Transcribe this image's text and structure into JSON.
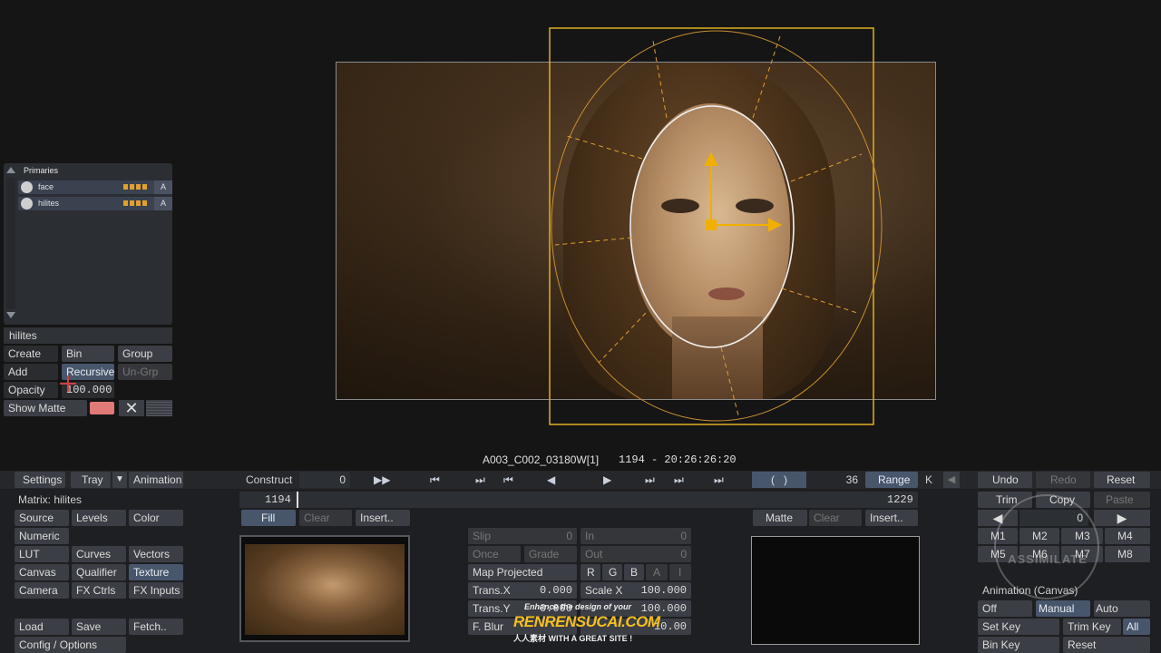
{
  "tray": {
    "title": "Primaries",
    "layers": [
      {
        "name": "face",
        "tag": "A"
      },
      {
        "name": "hilites",
        "tag": "A"
      }
    ],
    "selected_name": "hilites",
    "create": "Create",
    "bin": "Bin",
    "group": "Group",
    "add": "Add",
    "recursive": "Recursive",
    "ungrp": "Un-Grp",
    "opacity_label": "Opacity",
    "opacity_value": "100.000",
    "show_matte": "Show Matte"
  },
  "clip": {
    "name": "A003_C002_03180W[1]",
    "timecode": "1194 - 20:26:26:20"
  },
  "toolbar": {
    "settings": "Settings",
    "tray": "Tray",
    "animation": "Animation",
    "construct": "Construct",
    "construct_value": "0",
    "frame_count": "36",
    "range": "Range",
    "k": "K",
    "undo": "Undo",
    "redo": "Redo",
    "reset": "Reset"
  },
  "timeline": {
    "start": "1194",
    "end": "1229",
    "fill": "Fill",
    "clear": "Clear",
    "insert": "Insert..",
    "matte": "Matte",
    "matte_clear": "Clear",
    "matte_insert": "Insert.."
  },
  "menu": {
    "matrix": "Matrix: hilites",
    "items": [
      "Source",
      "Levels",
      "Color",
      "Numeric",
      "LUT",
      "Curves",
      "Vectors",
      "Canvas",
      "Qualifier",
      "Texture",
      "Camera",
      "FX Ctrls",
      "FX Inputs"
    ],
    "load": "Load",
    "save": "Save",
    "fetch": "Fetch..",
    "config": "Config / Options"
  },
  "params": {
    "slip": "Slip",
    "slip_val": "0",
    "in": "In",
    "in_val": "0",
    "once": "Once",
    "grade": "Grade",
    "out": "Out",
    "out_val": "0",
    "map": "Map Projected",
    "r": "R",
    "g": "G",
    "b": "B",
    "a": "A",
    "i": "I",
    "transx": "Trans.X",
    "transx_val": "0.000",
    "scalex": "Scale X",
    "scalex_val": "100.000",
    "transy": "Trans.Y",
    "transy_val": "0.000",
    "scaley_val": "100.000",
    "fblur": "F. Blur",
    "fblur_val": "10.00"
  },
  "right": {
    "trim": "Trim",
    "copy": "Copy",
    "paste": "Paste",
    "keyvalue": "0",
    "m": [
      "M1",
      "M2",
      "M3",
      "M4",
      "M5",
      "M6",
      "M7",
      "M8"
    ],
    "anim_label": "Animation (Canvas)",
    "off": "Off",
    "manual": "Manual",
    "auto": "Auto",
    "setkey": "Set Key",
    "trimkey": "Trim Key",
    "all": "All",
    "binkey": "Bin Key",
    "reset": "Reset",
    "logo": "ASSIMILATE"
  },
  "watermark": {
    "line1": "Enhance the design of your",
    "line2": "RENRENSUCAI.COM",
    "line3": "人人素材  WITH A GREAT SITE !"
  }
}
